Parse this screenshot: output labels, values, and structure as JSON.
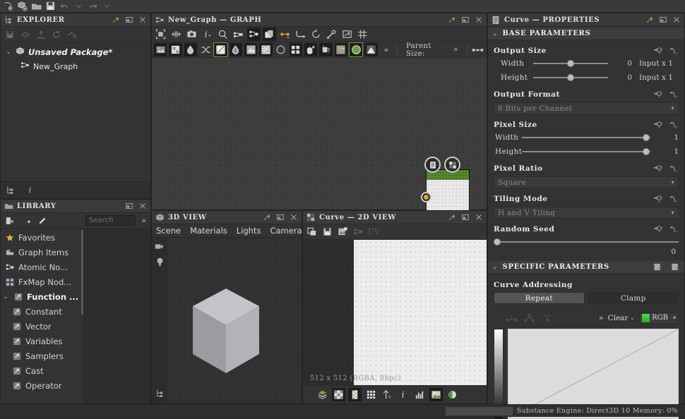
{
  "app_toolbar": {
    "items": [
      {
        "name": "new-graph-icon",
        "glyph": "new"
      },
      {
        "name": "new-package-icon",
        "glyph": "pkg"
      },
      {
        "name": "open-package-icon",
        "glyph": "folder"
      },
      {
        "name": "save-package-icon",
        "glyph": "save"
      },
      {
        "name": "undo-icon",
        "glyph": "undo"
      },
      {
        "name": "undo-history-dropdown-icon",
        "glyph": "caret"
      },
      {
        "name": "redo-icon",
        "glyph": "redo"
      },
      {
        "name": "redo-history-dropdown-icon",
        "glyph": "caret"
      }
    ]
  },
  "explorer": {
    "title": "EXPLORER",
    "toolbar": [
      "save-icon",
      "refresh-icon",
      "export-icon",
      "reload-icon",
      "link-icon"
    ],
    "package": {
      "label": "Unsaved Package*",
      "caret": "⌄"
    },
    "graph": {
      "label": "New_Graph"
    },
    "footer_icons": [
      "explorer-tree-icon",
      "info-icon"
    ]
  },
  "library": {
    "title": "LIBRARY",
    "toolbar": [
      "new-category-icon",
      "new-filter-icon",
      "edit-icon"
    ],
    "search": {
      "placeholder": "Search",
      "value": "",
      "expand": "»"
    },
    "items": [
      {
        "label": "Favorites",
        "icon": "star-icon",
        "group": false
      },
      {
        "label": "Graph Items",
        "icon": "graph-items-icon",
        "group": false
      },
      {
        "label": "Atomic No...",
        "icon": "atomic-nodes-icon",
        "group": false
      },
      {
        "label": "FxMap Nod...",
        "icon": "fxmap-nodes-icon",
        "group": false
      },
      {
        "label": "Function ...",
        "icon": "functions-icon",
        "group": true
      },
      {
        "label": "Constant",
        "icon": "function-icon",
        "group": false,
        "sub": true
      },
      {
        "label": "Vector",
        "icon": "function-icon",
        "group": false,
        "sub": true
      },
      {
        "label": "Variables",
        "icon": "function-icon",
        "group": false,
        "sub": true
      },
      {
        "label": "Samplers",
        "icon": "function-icon",
        "group": false,
        "sub": true
      },
      {
        "label": "Cast",
        "icon": "function-icon",
        "group": false,
        "sub": true
      },
      {
        "label": "Operator",
        "icon": "function-icon",
        "group": false,
        "sub": true
      }
    ]
  },
  "graph": {
    "title": "New_Graph  —  GRAPH",
    "toolbar_row1": [
      "frame-all-icon",
      "move-tool-icon",
      "screenshot-icon",
      "info-icon",
      "zoom-icon",
      "connect-icon",
      "graph-node-icon",
      "duplicate-icon",
      "link-node-icon",
      "curve-node-icon",
      "refresh-node-icon",
      "wrench-icon",
      "output-node-icon",
      "grid-icon"
    ],
    "toolbar_row2": [
      "bitmap-icon",
      "svg-icon",
      "blend-icon",
      "shuffle-icon",
      "curve-icon",
      "water-icon",
      "transform-icon",
      "noise-icon",
      "circle-icon",
      "tile-icon",
      "extrude-icon",
      "pour-icon",
      "dot-icon",
      "sphere-icon",
      "gradient-icon"
    ],
    "more": "»",
    "parent_size": {
      "label": "Parent Size:",
      "chevron": "»"
    },
    "node": {
      "name": "curve-node",
      "badges": [
        "doc-badge-icon",
        "2d-view-badge-icon"
      ]
    }
  },
  "view3d": {
    "title": "3D VIEW",
    "menu": [
      "Scene",
      "Materials",
      "Lights",
      "Camera"
    ],
    "rail": [
      "camera-icon",
      "light-icon",
      "scene-tree-icon"
    ]
  },
  "view2d": {
    "title": "Curve  —  2D VIEW",
    "toolbar": [
      "copy-icon",
      "save-icon",
      "export-icon",
      "link-icon",
      "uv-icon"
    ],
    "resolution": "512 x 512 (RGBA, 8bpc)",
    "footer": [
      "layers-icon",
      "checker-icon",
      "channel-icon",
      "grid-icon",
      "compare-icon",
      "info-icon",
      "histogram-icon",
      "image-icon",
      "split-icon"
    ]
  },
  "properties": {
    "title": "Curve  —  PROPERTIES",
    "sections": [
      {
        "name": "BASE PARAMETERS",
        "caret": "⌄"
      },
      {
        "name": "SPECIFIC PARAMETERS",
        "caret": "⌄"
      }
    ],
    "output_size": {
      "label": "Output Size",
      "width": {
        "label": "Width",
        "value": "0",
        "extra": "Input x 1",
        "knob_pct": 45
      },
      "height": {
        "label": "Height",
        "value": "0",
        "extra": "Input x 1",
        "knob_pct": 45
      }
    },
    "output_format": {
      "label": "Output Format",
      "value": "8 Bits per Channel"
    },
    "pixel_size": {
      "label": "Pixel Size",
      "width": {
        "label": "Width",
        "value": "1",
        "knob_pct": 97
      },
      "height": {
        "label": "Height",
        "value": "1",
        "knob_pct": 97
      }
    },
    "pixel_ratio": {
      "label": "Pixel Ratio",
      "value": "Square"
    },
    "tiling_mode": {
      "label": "Tiling Mode",
      "value": "H and V Tiling"
    },
    "random_seed": {
      "label": "Random Seed",
      "value": "0",
      "knob_pct": 1
    },
    "curve_addressing": {
      "label": "Curve Addressing",
      "repeat": "Repeat",
      "clamp": "Clamp",
      "selected": "Repeat"
    },
    "curve_toolbar": {
      "tools": [
        "curve-linear-icon",
        "curve-smooth-icon",
        "curve-corner-icon"
      ],
      "more": "»",
      "clear": "Clear",
      "clear_caret": "⌄",
      "channel": "RGB",
      "channel_caret": "▾"
    },
    "accent": "#7a9b3c"
  },
  "status": {
    "text": "Substance Engine: Direct3D 10 Memory: 0%"
  }
}
